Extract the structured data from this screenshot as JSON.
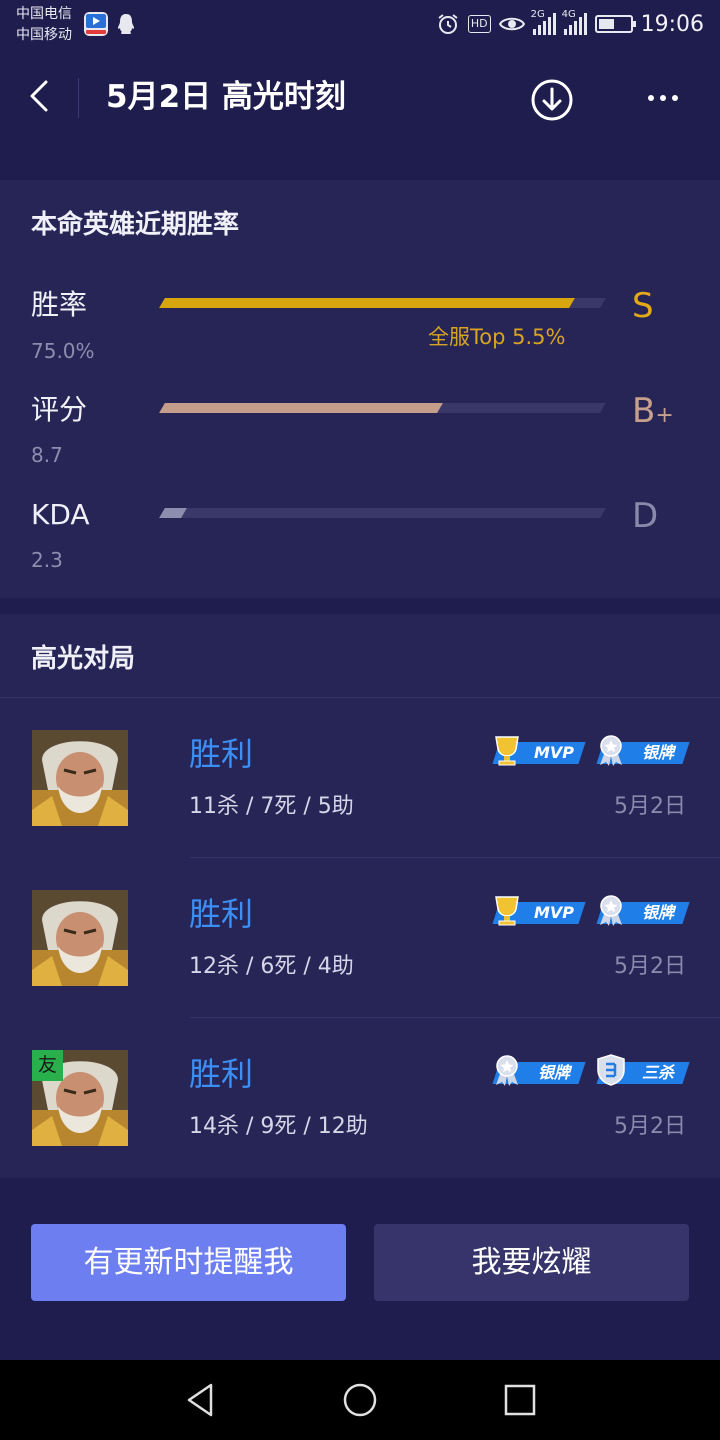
{
  "status_bar": {
    "carrier_1": "中国电信",
    "carrier_2": "中国移动",
    "network_1": "2G",
    "network_2": "4G",
    "hd": "HD",
    "time": "19:06",
    "battery_level": 0.5,
    "icons": [
      "video-app-icon",
      "qq-icon",
      "alarm-icon",
      "hd-icon",
      "eye-icon",
      "signal-icon",
      "battery-icon"
    ]
  },
  "header": {
    "title": "5月2日 高光时刻",
    "icons": [
      "back-icon",
      "download-icon",
      "more-icon"
    ]
  },
  "winrate_section": {
    "title": "本命英雄近期胜率",
    "stats": [
      {
        "label": "胜率",
        "value": "75.0%",
        "grade": "S",
        "grade_suffix": "",
        "fill": 0.93,
        "color": "#d7a60f",
        "grade_color": "#e3aa18"
      },
      {
        "label": "评分",
        "value": "8.7",
        "grade": "B",
        "grade_suffix": "+",
        "fill": 0.63,
        "color": "#c49e8a",
        "grade_color": "#c6a08c"
      },
      {
        "label": "KDA",
        "value": "2.3",
        "grade": "D",
        "grade_suffix": "",
        "fill": 0.05,
        "color": "#8f8daf",
        "grade_color": "#8b89ab"
      }
    ],
    "top_note": "全服Top 5.5%"
  },
  "highlight_section": {
    "title": "高光对局",
    "games": [
      {
        "result": "胜利",
        "kda": "11杀 / 7死 / 5助",
        "date": "5月2日",
        "friend_tag": "",
        "badges": [
          "MVP",
          "银牌"
        ]
      },
      {
        "result": "胜利",
        "kda": "12杀 / 6死 / 4助",
        "date": "5月2日",
        "friend_tag": "",
        "badges": [
          "MVP",
          "银牌"
        ]
      },
      {
        "result": "胜利",
        "kda": "14杀 / 9死 / 12助",
        "date": "5月2日",
        "friend_tag": "友",
        "badges": [
          "银牌",
          "三杀"
        ]
      }
    ]
  },
  "actions": {
    "remind": "有更新时提醒我",
    "share": "我要炫耀"
  },
  "nav_bar": {
    "icons": [
      "back-triangle-icon",
      "home-circle-icon",
      "recents-square-icon"
    ]
  },
  "colors": {
    "background": "#1f1d4d",
    "card": "#272456",
    "accent_blue": "#3c8ff4",
    "button_primary": "#6d7ff0",
    "button_secondary": "#36346a"
  }
}
